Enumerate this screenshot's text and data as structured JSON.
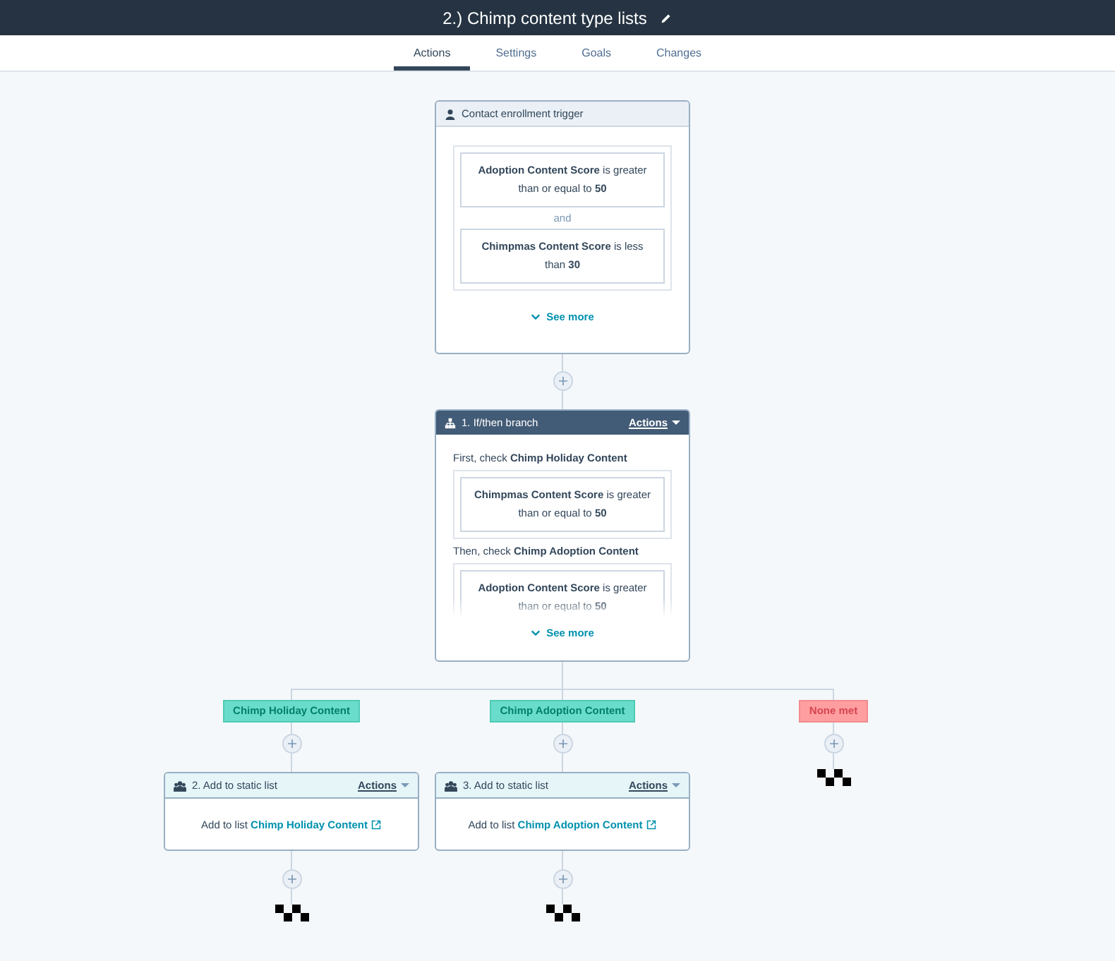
{
  "header": {
    "title": "2.) Chimp content type lists"
  },
  "tabs": [
    {
      "label": "Actions",
      "selected": true
    },
    {
      "label": "Settings",
      "selected": false
    },
    {
      "label": "Goals",
      "selected": false
    },
    {
      "label": "Changes",
      "selected": false
    }
  ],
  "trigger": {
    "title": "Contact enrollment trigger",
    "conditions": [
      "**Adoption Content Score** is greater than or equal to **50**",
      "**Chimpmas Content Score** is less than **30**"
    ],
    "joiner": "and",
    "see_more": "See more"
  },
  "branch_action": {
    "title": "1. If/then branch",
    "menu": "Actions",
    "checks": [
      {
        "intro": "First, check **Chimp Holiday Content**",
        "condition": "**Chimpmas Content Score** is greater than or equal to **50**"
      },
      {
        "intro": "Then, check **Chimp Adoption Content**",
        "condition": "**Adoption Content Score** is greater than or equal to **50**"
      }
    ],
    "see_more": "See more"
  },
  "branches": [
    {
      "label": "Chimp Holiday Content",
      "kind": "branch",
      "action": {
        "title": "2. Add to static list",
        "menu": "Actions",
        "prefix": "Add to list",
        "list": "Chimp Holiday Content"
      }
    },
    {
      "label": "Chimp Adoption Content",
      "kind": "branch",
      "action": {
        "title": "3. Add to static list",
        "menu": "Actions",
        "prefix": "Add to list",
        "list": "Chimp Adoption Content"
      }
    },
    {
      "label": "None met",
      "kind": "fallback"
    }
  ]
}
